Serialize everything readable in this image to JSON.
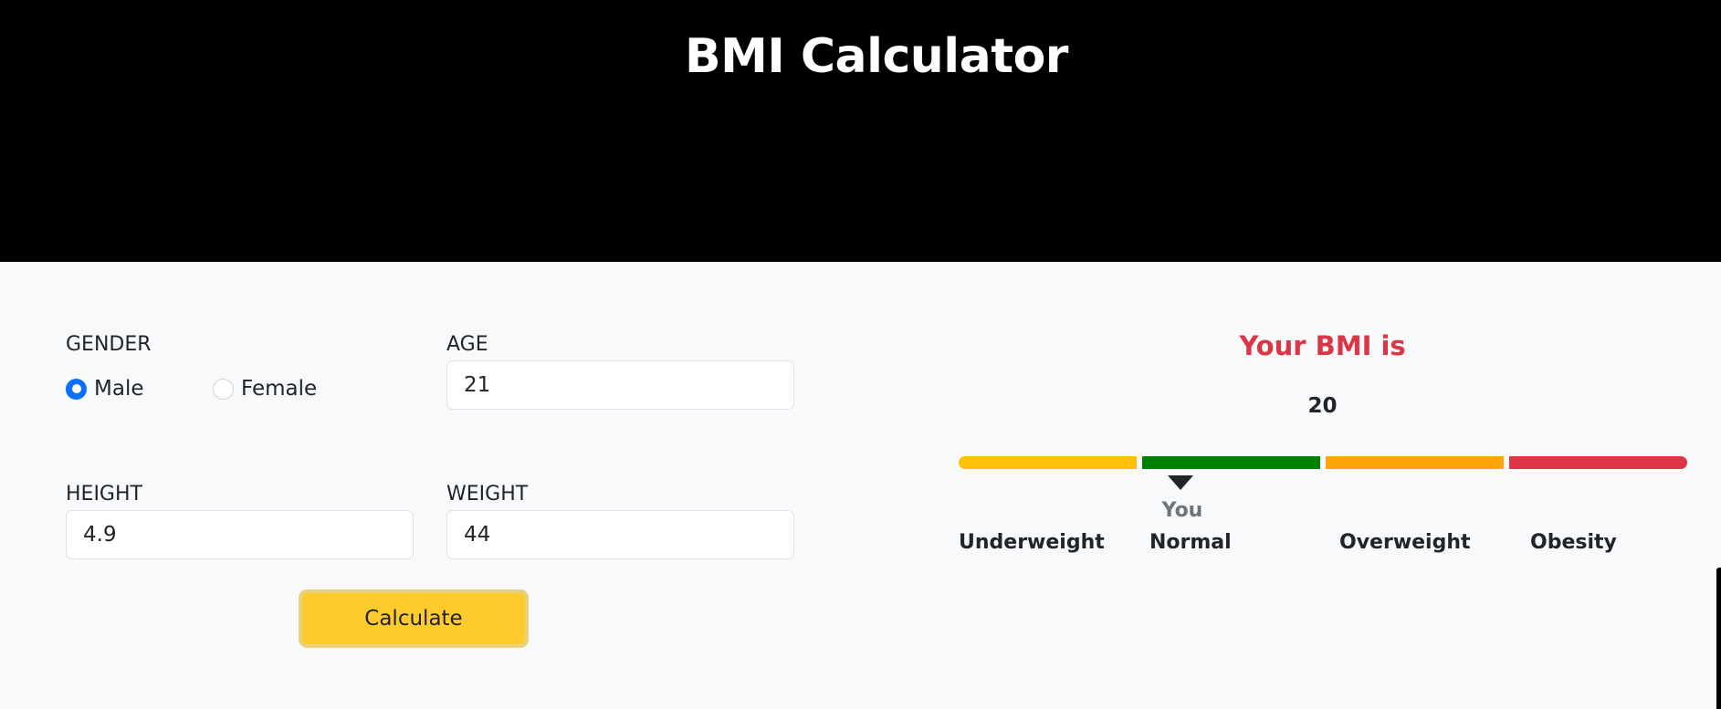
{
  "header": {
    "title": "BMI Calculator"
  },
  "form": {
    "gender": {
      "label": "GENDER",
      "options": [
        {
          "label": "Male",
          "checked": true
        },
        {
          "label": "Female",
          "checked": false
        }
      ]
    },
    "age": {
      "label": "AGE",
      "value": "21"
    },
    "height": {
      "label": "HEIGHT",
      "value": "4.9"
    },
    "weight": {
      "label": "WEIGHT",
      "value": "44"
    },
    "calculate_label": "Calculate"
  },
  "result": {
    "title": "Your BMI is",
    "value": "20",
    "you_label": "You",
    "categories": [
      {
        "label": "Underweight",
        "color": "#ffc107"
      },
      {
        "label": "Normal",
        "color": "#008000"
      },
      {
        "label": "Overweight",
        "color": "#ffa50a"
      },
      {
        "label": "Obesity",
        "color": "#dc3545"
      }
    ],
    "current_category": "Normal"
  },
  "colors": {
    "header_bg": "#000000",
    "page_bg": "#f8f9fa",
    "accent_radio": "#0d6efd",
    "button": "#ffca2c",
    "bmi_title": "#dc3545"
  }
}
